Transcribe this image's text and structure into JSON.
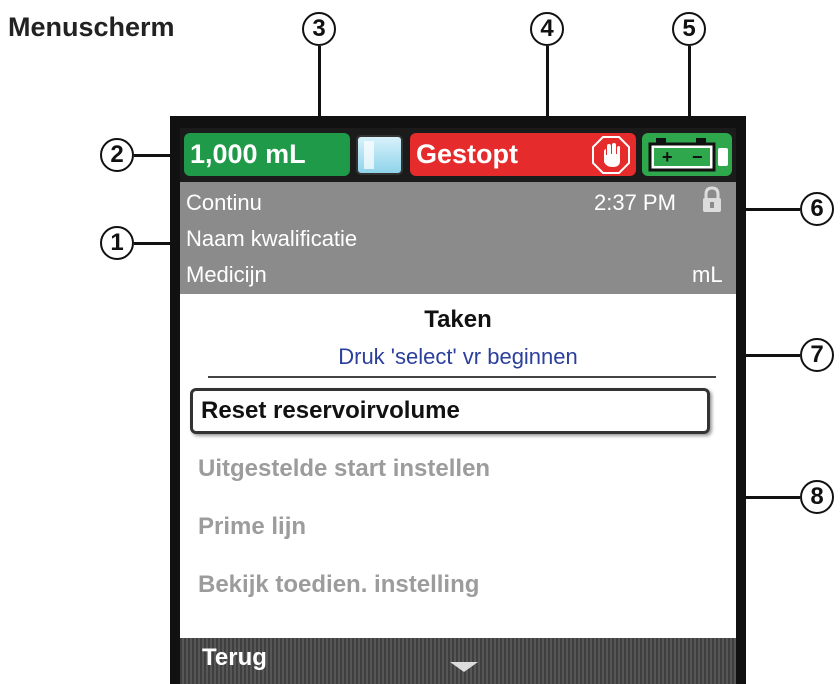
{
  "figure": {
    "title": "Menuscherm"
  },
  "callouts": [
    "1",
    "2",
    "3",
    "4",
    "5",
    "6",
    "7",
    "8"
  ],
  "status_bar": {
    "volume": "1,000 mL",
    "state": "Gestopt",
    "colors": {
      "volume_bg": "#1f9a48",
      "state_bg": "#e52b2b",
      "battery_bg": "#2fa84d"
    },
    "icons": {
      "container": "fluid-bag-icon",
      "stop": "stop-hand-icon",
      "battery": "battery-icon",
      "lock": "lock-icon"
    }
  },
  "info": {
    "mode": "Continu",
    "time": "2:37 PM",
    "qualification": "Naam kwalificatie",
    "drug": "Medicijn",
    "unit": "mL"
  },
  "menu": {
    "title": "Taken",
    "subtitle": "Druk 'select' vr beginnen",
    "items": [
      {
        "label": "Reset reservoirvolume",
        "state": "selected"
      },
      {
        "label": "Uitgestelde start instellen",
        "state": "disabled"
      },
      {
        "label": "Prime lijn",
        "state": "disabled"
      },
      {
        "label": "Bekijk toedien. instelling",
        "state": "disabled"
      }
    ]
  },
  "softkeys": {
    "left": "Terug",
    "scroll_icon": "scroll-down-icon"
  }
}
